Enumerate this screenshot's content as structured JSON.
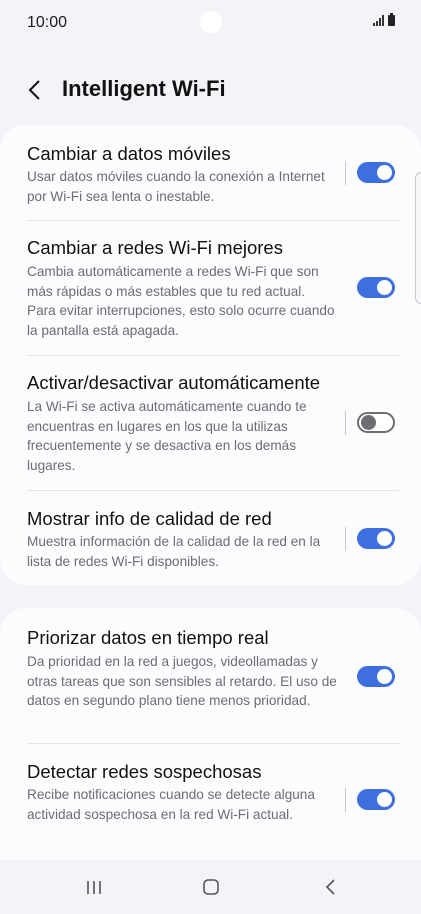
{
  "status_bar": {
    "time": "10:00"
  },
  "header": {
    "title": "Intelligent Wi-Fi"
  },
  "sections": [
    {
      "items": [
        {
          "title": "Cambiar a datos móviles",
          "description": "Usar datos móviles cuando la conexión a Internet por Wi-Fi sea lenta o inestable.",
          "enabled": true
        },
        {
          "title": "Cambiar a redes Wi-Fi mejores",
          "description": "Cambia automáticamente a redes Wi-Fi que son más rápidas o más estables que tu red actual. Para evitar interrupciones, esto solo ocurre cuando la pantalla está apagada.",
          "enabled": true
        },
        {
          "title": "Activar/desactivar automáticamente",
          "description": "La Wi-Fi se activa automáticamente cuando te encuentras en lugares en los que la utilizas frecuentemente y se desactiva en los demás lugares.",
          "enabled": false
        },
        {
          "title": "Mostrar info de calidad de red",
          "description": "Muestra información de la calidad de la red en la lista de redes Wi-Fi disponibles.",
          "enabled": true
        }
      ]
    },
    {
      "items": [
        {
          "title": "Priorizar datos en tiempo real",
          "description": "Da prioridad en la red a juegos, videollamadas y otras tareas que son sensibles al retardo. El uso de datos en segundo plano tiene menos prioridad.",
          "enabled": true
        },
        {
          "title": "Detectar redes sospechosas",
          "description": "Recibe notificaciones cuando se detecte alguna actividad sospechosa en la red Wi-Fi actual.",
          "enabled": true
        }
      ]
    }
  ],
  "icons": {
    "back": "chevron-left-icon",
    "recents": "recents-icon",
    "home": "home-icon",
    "nav_back": "back-icon"
  },
  "colors": {
    "accent": "#3e6fe0",
    "background": "#f4f3f8",
    "card": "#fcfcff",
    "toggle_off": "#6d6d72"
  }
}
